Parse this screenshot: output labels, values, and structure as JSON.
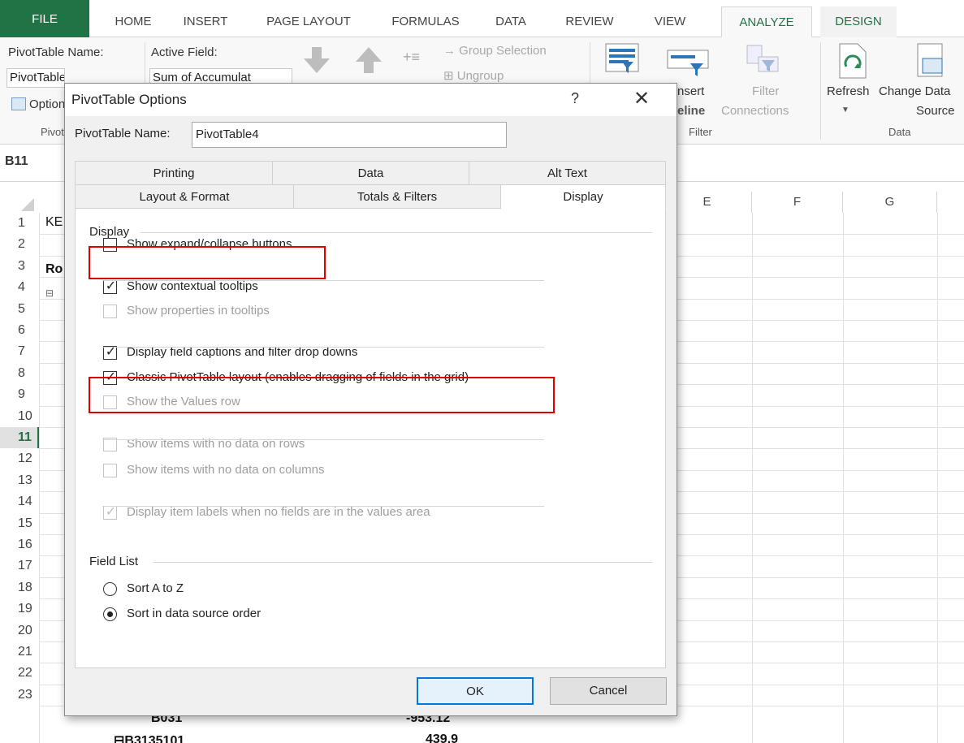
{
  "ribbon_tabs": [
    "FILE",
    "HOME",
    "INSERT",
    "PAGE LAYOUT",
    "FORMULAS",
    "DATA",
    "REVIEW",
    "VIEW",
    "ANALYZE",
    "DESIGN"
  ],
  "ribbon": {
    "pivot_name_label": "PivotTable Name:",
    "pivot_name_value": "PivotTable4",
    "active_field_label": "Active Field:",
    "active_field_value": "Sum of Accumulat",
    "options_label": "Options",
    "pivot_group_label": "PivotTable",
    "group_selection": "Group Selection",
    "ungroup": "Ungroup",
    "insert_timeline": "Insert Timeline",
    "filter_connections_1": "Filter",
    "filter_connections_2": "Connections",
    "filter_group": "Filter",
    "refresh": "Refresh",
    "change_data_source_1": "Change Data",
    "change_data_source_2": "Source",
    "data_group": "Data"
  },
  "name_box": "B11",
  "grid": {
    "columns": [
      "E",
      "F",
      "G"
    ],
    "rows": [
      "1",
      "2",
      "3",
      "4",
      "5",
      "6",
      "7",
      "8",
      "9",
      "10",
      "11",
      "12",
      "13",
      "14",
      "15",
      "16",
      "17",
      "18",
      "19",
      "20",
      "21",
      "22",
      "23"
    ],
    "selected_row": "11",
    "cell_a1": "KE",
    "cell_a3": "Ro",
    "cell_b22": "B031",
    "cell_c22": "-953.12",
    "cell_b23": "B3135101",
    "cell_c23": "439.9"
  },
  "dialog": {
    "title": "PivotTable Options",
    "help": "?",
    "close": "✕",
    "name_label": "PivotTable Name:",
    "name_value": "PivotTable4",
    "tabs_row1": [
      "Printing",
      "Data",
      "Alt Text"
    ],
    "tabs_row2": [
      "Layout & Format",
      "Totals & Filters",
      "Display"
    ],
    "display_section": "Display",
    "options": [
      {
        "label": "Show expand/collapse buttons",
        "checked": false,
        "disabled": false
      },
      {
        "label": "Show contextual tooltips",
        "checked": true,
        "disabled": false
      },
      {
        "label": "Show properties in tooltips",
        "checked": false,
        "disabled": true
      },
      {
        "label": "Display field captions and filter drop downs",
        "checked": true,
        "disabled": false
      },
      {
        "label": "Classic PivotTable layout (enables dragging of fields in the grid)",
        "checked": true,
        "disabled": false
      },
      {
        "label": "Show the Values row",
        "checked": false,
        "disabled": true
      },
      {
        "label": "Show items with no data on rows",
        "checked": false,
        "disabled": true
      },
      {
        "label": "Show items with no data on columns",
        "checked": false,
        "disabled": true
      },
      {
        "label": "Display item labels when no fields are in the values area",
        "checked": true,
        "disabled": true
      }
    ],
    "field_list_section": "Field List",
    "sort_a_to_z": "Sort A to Z",
    "sort_source_order": "Sort in data source order",
    "ok": "OK",
    "cancel": "Cancel"
  },
  "colors": {
    "excel_green": "#217346",
    "highlight_red": "#e00000",
    "ok_blue": "#0078d7"
  }
}
